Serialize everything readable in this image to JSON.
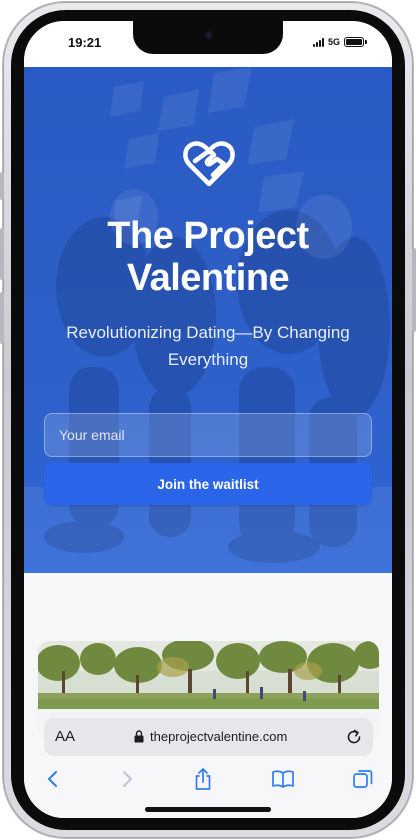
{
  "status_bar": {
    "time": "19:21",
    "network": "5G"
  },
  "hero": {
    "logo_icon": "heart-handshake-icon",
    "title": "The Project Valentine",
    "subtitle": "Revolutionizing Dating—By Changing Everything",
    "email_placeholder": "Your email",
    "email_value": "",
    "button_label": "Join the waitlist"
  },
  "browser": {
    "text_size_label": "AA",
    "url": "theprojectvalentine.com",
    "lock_icon": "lock-icon",
    "reload_icon": "reload-icon",
    "toolbar": [
      "back-icon",
      "forward-icon",
      "share-icon",
      "bookmarks-icon",
      "tabs-icon"
    ]
  },
  "colors": {
    "hero_blue": "#2d5ec6",
    "button_blue": "#2a64e8",
    "browser_accent": "#2f7bf5",
    "page_background": "#f6f7f9"
  }
}
